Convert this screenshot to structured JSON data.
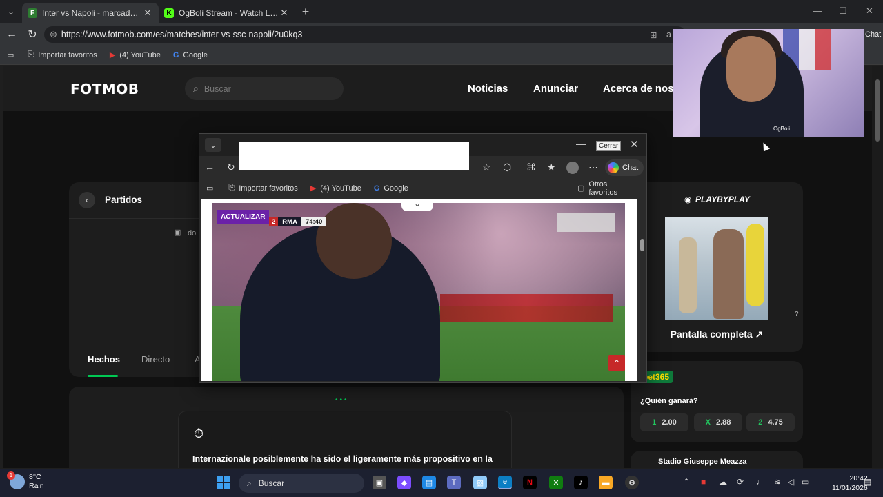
{
  "browser": {
    "tabs": [
      {
        "title": "Inter vs Napoli - marcador en vivo",
        "favicon": "F",
        "active": true
      },
      {
        "title": "OgBoli Stream - Watch Live on Kick",
        "favicon": "K",
        "active": false
      }
    ],
    "url": "https://www.fotmob.com/es/matches/inter-vs-ssc-napoli/2u0kq3",
    "url_tail_fragment": "a",
    "chat_label": "Chat",
    "bookmarks": [
      {
        "label": "Importar favoritos",
        "icon": "import-icon"
      },
      {
        "label": "(4) YouTube",
        "icon": "youtube-icon"
      },
      {
        "label": "Google",
        "icon": "google-icon"
      }
    ]
  },
  "fotmob": {
    "logo": "FOTMOB",
    "search_placeholder": "Buscar",
    "nav": [
      "Noticias",
      "Anunciar",
      "Acerca de nos"
    ],
    "partidos_title": "Partidos",
    "date_fragment": "do",
    "tabs": [
      "Hechos",
      "Directo",
      "A"
    ],
    "insight_text": "Internazionale posiblemente ha sido el ligeramente más propositivo en la",
    "playbyplay_title": "PLAYBYPLAY",
    "playbyplay_fullscreen": "Pantalla completa",
    "help_icon": "?",
    "bet_logo": "bet365",
    "bet_question": "¿Quién ganará?",
    "odds": [
      {
        "key": "1",
        "value": "2.00"
      },
      {
        "key": "X",
        "value": "2.88"
      },
      {
        "key": "2",
        "value": "4.75"
      }
    ],
    "stadium": "Stadio Giuseppe Meazza"
  },
  "popup": {
    "tooltip": "Cerrar",
    "chat_label": "Chat",
    "bookmarks": [
      "Importar favoritos",
      "(4) YouTube",
      "Google"
    ],
    "other_favs": "Otros favoritos",
    "video": {
      "actualizar": "ACTUALIZAR",
      "score": "2",
      "team": "RMA",
      "clock": "74:40"
    }
  },
  "webcam": {
    "tag": "OgBoli"
  },
  "taskbar": {
    "weather_temp": "8°C",
    "weather_desc": "Rain",
    "weather_badge": "1",
    "search_label": "Buscar",
    "time": "20:42",
    "date": "11/01/2026"
  },
  "colors": {
    "accent_green": "#00c853",
    "purple": "#6b21a8",
    "bet_green": "#0f7a3b"
  }
}
